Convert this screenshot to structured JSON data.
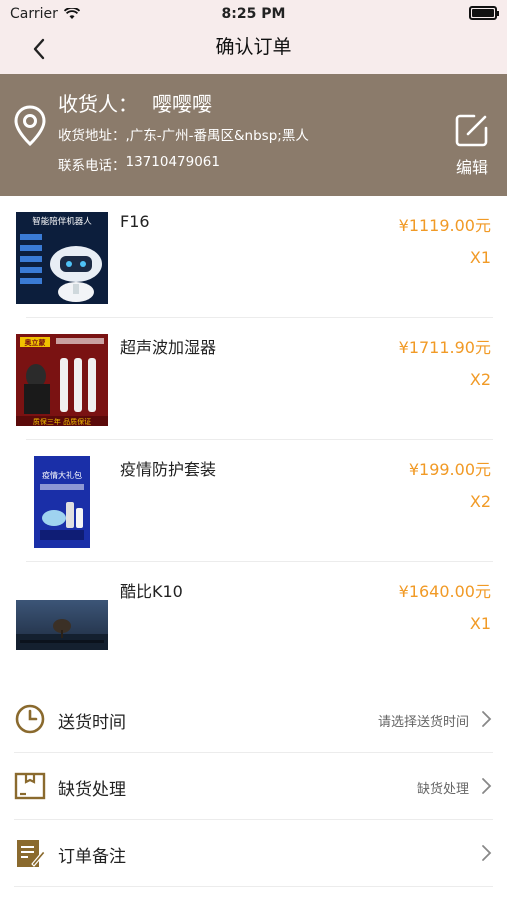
{
  "status_bar": {
    "carrier": "Carrier",
    "time": "8:25 PM"
  },
  "nav": {
    "title": "确认订单"
  },
  "address": {
    "receiver_label": "收货人：",
    "receiver_name": "嘤嘤嘤",
    "address_label": "收货地址：",
    "address_value": ",广东-广州-番禺区&nbsp;黑人",
    "phone_label": "联系电话：",
    "phone_value": "13710479061",
    "edit_label": "编辑"
  },
  "products": [
    {
      "name": "F16",
      "price": "¥1119.00元",
      "qty": "X1",
      "image": "robot"
    },
    {
      "name": "超声波加湿器",
      "price": "¥1711.90元",
      "qty": "X2",
      "image": "humidifier"
    },
    {
      "name": "疫情防护套装",
      "price": "¥199.00元",
      "qty": "X2",
      "image": "protection-kit"
    },
    {
      "name": "酷比K10",
      "price": "¥1640.00元",
      "qty": "X1",
      "image": "tv"
    }
  ],
  "image_text": {
    "robot_banner": "智能陪伴机器人",
    "humid_banner": "奥立蒙",
    "humid_footer": "质保三年 品质保证",
    "kit_banner": "疫情大礼包"
  },
  "options": [
    {
      "label": "送货时间",
      "value": "请选择送货时间",
      "icon": "clock-icon"
    },
    {
      "label": "缺货处理",
      "value": "缺货处理",
      "icon": "box-icon"
    },
    {
      "label": "订单备注",
      "value": "",
      "icon": "note-icon"
    }
  ],
  "colors": {
    "header_bg": "#f7ecec",
    "address_bg": "#8b7b6b",
    "accent": "#f19a26",
    "icon_brown": "#8a6a2e"
  }
}
